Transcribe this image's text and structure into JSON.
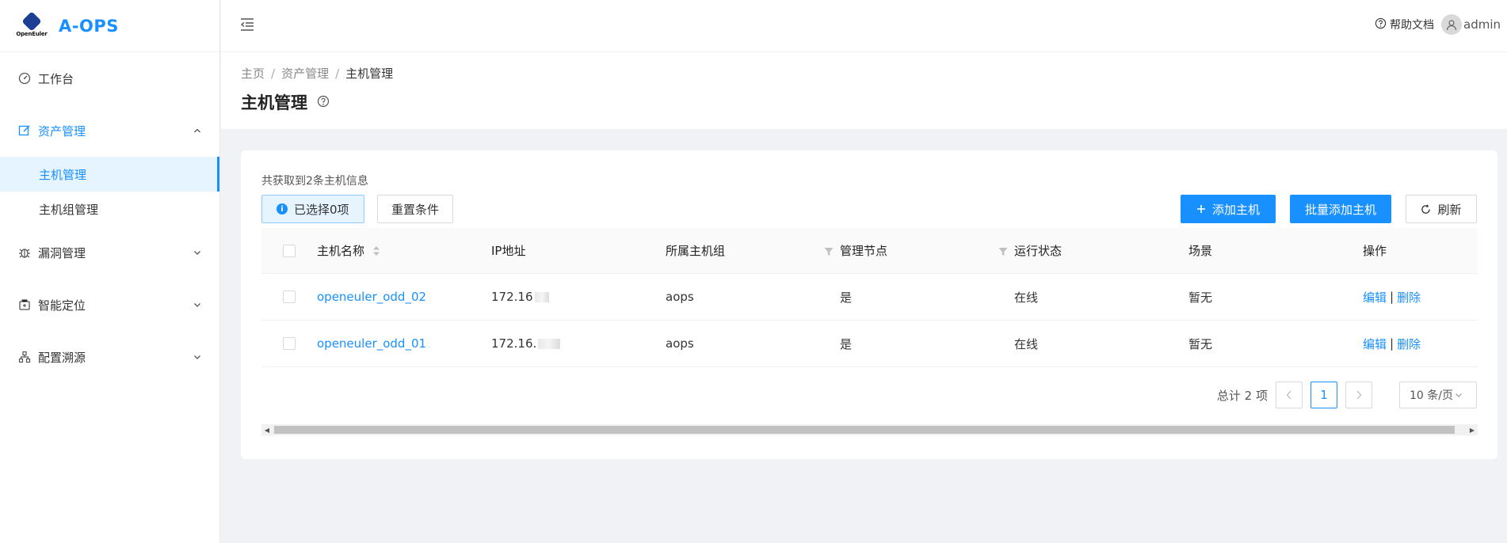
{
  "app": {
    "brand": "OpenEuler",
    "title": "A-OPS"
  },
  "header": {
    "help_label": "帮助文档",
    "user_name": "admin"
  },
  "sidebar": {
    "items": [
      {
        "label": "工作台",
        "icon": "dashboard-icon"
      },
      {
        "label": "资产管理",
        "icon": "edit-icon",
        "expanded": true,
        "children": [
          {
            "label": "主机管理",
            "selected": true
          },
          {
            "label": "主机组管理"
          }
        ]
      },
      {
        "label": "漏洞管理",
        "icon": "bug-icon"
      },
      {
        "label": "智能定位",
        "icon": "locate-icon"
      },
      {
        "label": "配置溯源",
        "icon": "cluster-icon"
      }
    ]
  },
  "breadcrumb": [
    "主页",
    "资产管理",
    "主机管理"
  ],
  "page": {
    "title": "主机管理"
  },
  "toolbar": {
    "count_text": "共获取到2条主机信息",
    "selected_text": "已选择0项",
    "reset_label": "重置条件",
    "add_host_label": "添加主机",
    "batch_add_label": "批量添加主机",
    "refresh_label": "刷新"
  },
  "table": {
    "columns": [
      "主机名称",
      "IP地址",
      "所属主机组",
      "管理节点",
      "运行状态",
      "场景",
      "操作"
    ],
    "rows": [
      {
        "name": "openeuler_odd_02",
        "ip": "172.16",
        "group": "aops",
        "node": "是",
        "status": "在线",
        "scene": "暂无",
        "edit": "编辑",
        "delete": "删除"
      },
      {
        "name": "openeuler_odd_01",
        "ip": "172.16.",
        "group": "aops",
        "node": "是",
        "status": "在线",
        "scene": "暂无",
        "edit": "编辑",
        "delete": "删除"
      }
    ]
  },
  "pagination": {
    "total_text": "总计 2 项",
    "current_page": "1",
    "page_size": "10 条/页"
  },
  "colors": {
    "primary": "#1890ff",
    "selected_bg": "#e6f4ff"
  }
}
